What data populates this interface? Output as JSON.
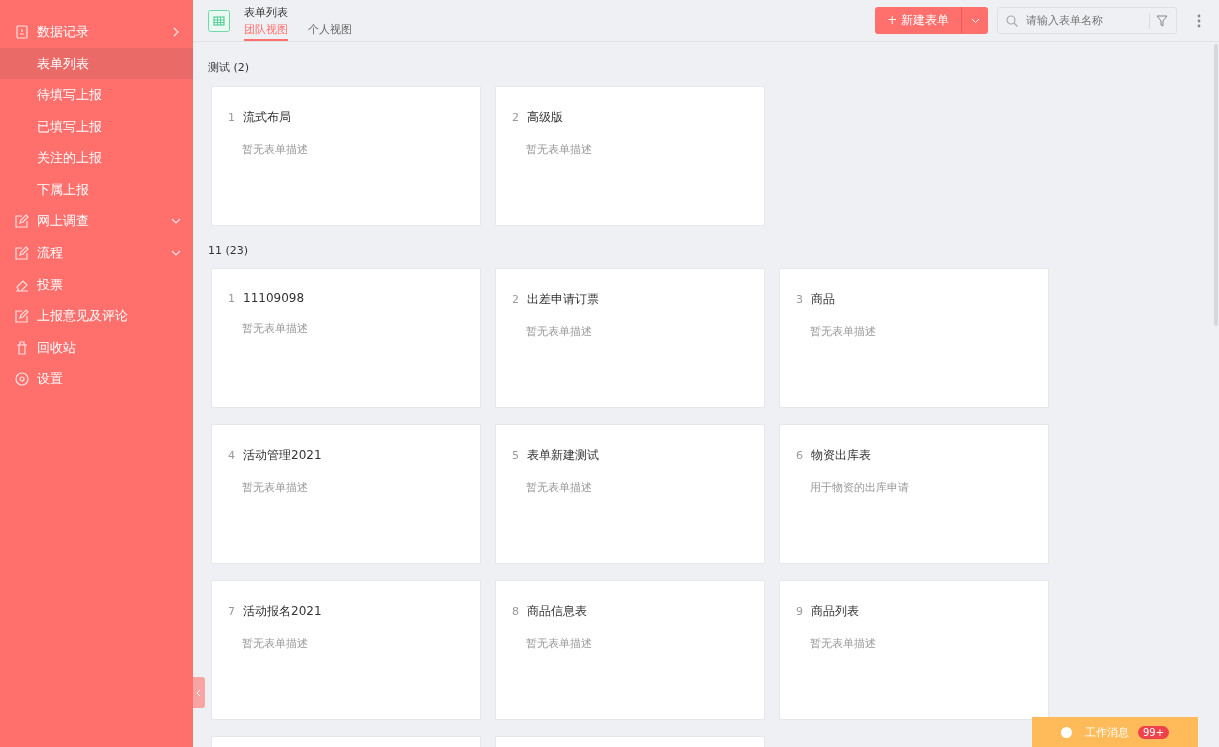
{
  "sidebar": {
    "items": [
      {
        "label": "数据记录",
        "expanded": true,
        "children": [
          {
            "label": "表单列表",
            "selected": true
          },
          {
            "label": "待填写上报",
            "selected": false
          },
          {
            "label": "已填写上报",
            "selected": false
          },
          {
            "label": "关注的上报",
            "selected": false
          },
          {
            "label": "下属上报",
            "selected": false
          }
        ]
      },
      {
        "label": "网上调查",
        "expanded": false
      },
      {
        "label": "流程",
        "expanded": false
      },
      {
        "label": "投票"
      },
      {
        "label": "上报意见及评论"
      },
      {
        "label": "回收站"
      },
      {
        "label": "设置"
      }
    ]
  },
  "header": {
    "title": "表单列表",
    "tabs": [
      {
        "label": "团队视图",
        "selected": true
      },
      {
        "label": "个人视图",
        "selected": false
      }
    ],
    "new_button": "+ 新建表单",
    "search": {
      "placeholder": "请输入表单名称"
    }
  },
  "groups": [
    {
      "title": "测试 (2)",
      "forms": [
        {
          "index": "1",
          "name": "流式布局",
          "description": "暂无表单描述"
        },
        {
          "index": "2",
          "name": "高级版",
          "description": "暂无表单描述"
        }
      ]
    },
    {
      "title": "11 (23)",
      "forms": [
        {
          "index": "1",
          "name": "11109098",
          "description": "暂无表单描述"
        },
        {
          "index": "2",
          "name": "出差申请订票",
          "description": "暂无表单描述"
        },
        {
          "index": "3",
          "name": "商品",
          "description": "暂无表单描述"
        },
        {
          "index": "4",
          "name": "活动管理2021",
          "description": "暂无表单描述"
        },
        {
          "index": "5",
          "name": "表单新建测试",
          "description": "暂无表单描述"
        },
        {
          "index": "6",
          "name": "物资出库表",
          "description": "用于物资的出库申请"
        },
        {
          "index": "7",
          "name": "活动报名2021",
          "description": "暂无表单描述"
        },
        {
          "index": "8",
          "name": "商品信息表",
          "description": "暂无表单描述"
        },
        {
          "index": "9",
          "name": "商品列表",
          "description": "暂无表单描述"
        }
      ],
      "cut_off_cards": [
        {
          "kind": "blank"
        },
        {
          "kind": "blank"
        }
      ]
    }
  ],
  "messages": {
    "label": "工作消息",
    "badge": "99+"
  }
}
